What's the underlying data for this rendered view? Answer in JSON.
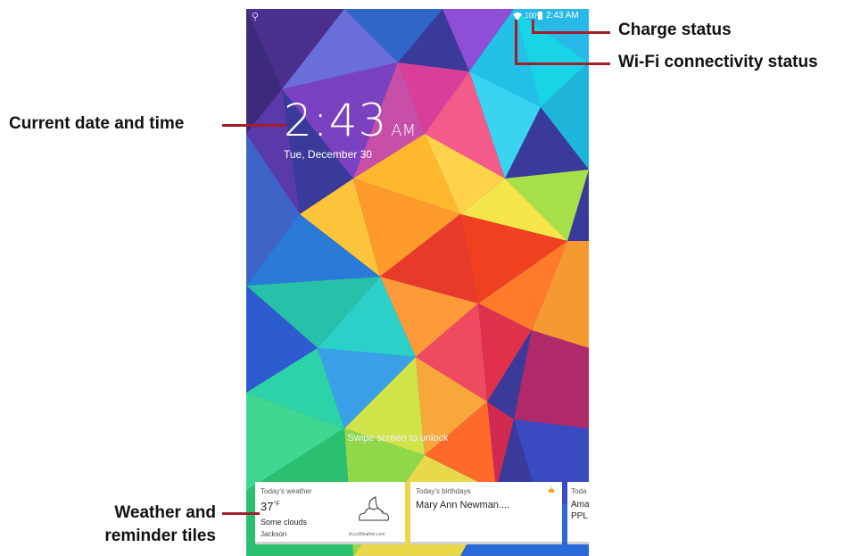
{
  "status_bar": {
    "battery_percent": "100%",
    "time": "2:43 AM",
    "icons": [
      "usb-icon",
      "wifi-icon",
      "battery-icon"
    ]
  },
  "lockscreen": {
    "clock_time": "2:43",
    "clock_ampm": "AM",
    "date": "Tue, December 30",
    "swipe_hint": "Swipe screen to unlock"
  },
  "tiles": {
    "weather": {
      "header": "Today's weather",
      "temp": "37",
      "unit": "°F",
      "condition": "Some clouds",
      "city": "Jackson",
      "provider": "AccuWeather.com",
      "icon": "partly-cloudy-night-icon"
    },
    "birthdays": {
      "header": "Today's birthdays",
      "name": "Mary Ann Newman....",
      "icon": "cake-icon"
    },
    "third": {
      "header": "Toda",
      "line1": "Ama",
      "line2": "PPL"
    }
  },
  "callouts": {
    "charge": "Charge status",
    "wifi": "Wi-Fi connectivity status",
    "date_time": "Current date and time",
    "tiles_line1": "Weather and",
    "tiles_line2": "reminder tiles"
  },
  "colors": {
    "callout_line": "#a31d2b"
  }
}
